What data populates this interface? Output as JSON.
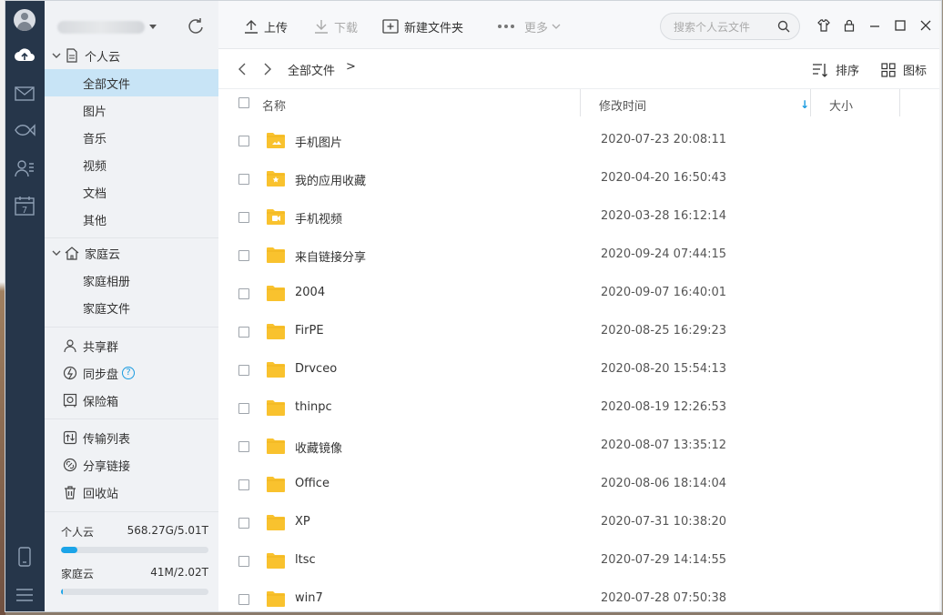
{
  "rail": {
    "icons": [
      "avatar-icon",
      "cloud-icon",
      "mail-icon",
      "fish-icon",
      "contacts-icon",
      "calendar-icon",
      "phone-icon",
      "menu-icon"
    ],
    "calendar_day": "7"
  },
  "sidebar": {
    "personal_cloud": {
      "label": "个人云",
      "items": [
        "全部文件",
        "图片",
        "音乐",
        "视频",
        "文档",
        "其他"
      ]
    },
    "family_cloud": {
      "label": "家庭云",
      "items": [
        "家庭相册",
        "家庭文件"
      ]
    },
    "utilities1": [
      {
        "label": "共享群",
        "icon": "people-icon"
      },
      {
        "label": "同步盘",
        "icon": "sync-disk-icon"
      },
      {
        "label": "保险箱",
        "icon": "safe-icon"
      }
    ],
    "help_glyph": "?",
    "utilities2": [
      {
        "label": "传输列表",
        "icon": "transfer-icon"
      },
      {
        "label": "分享链接",
        "icon": "share-link-icon"
      },
      {
        "label": "回收站",
        "icon": "trash-icon"
      }
    ],
    "quota": [
      {
        "label": "个人云",
        "value": "568.27G/5.01T",
        "fraction": 0.11
      },
      {
        "label": "家庭云",
        "value": "41M/2.02T",
        "fraction": 0.01
      }
    ]
  },
  "toolbar": {
    "upload": "上传",
    "download": "下载",
    "new_folder": "新建文件夹",
    "more": "更多",
    "search_placeholder": "搜索个人云文件"
  },
  "pathbar": {
    "crumb": "全部文件",
    "crumb_sep": ">",
    "sort": "排序",
    "view": "图标"
  },
  "columns": {
    "name": "名称",
    "modified": "修改时间",
    "size": "大小",
    "sort_glyph": "↓"
  },
  "files": [
    {
      "name": "手机图片",
      "date": "2020-07-23 20:08:11",
      "badge": "image"
    },
    {
      "name": "我的应用收藏",
      "date": "2020-04-20 16:50:43",
      "badge": "star"
    },
    {
      "name": "手机视频",
      "date": "2020-03-28 16:12:14",
      "badge": "video"
    },
    {
      "name": "来自链接分享",
      "date": "2020-09-24 07:44:15",
      "badge": ""
    },
    {
      "name": "2004",
      "date": "2020-09-07 16:40:01",
      "badge": ""
    },
    {
      "name": "FirPE",
      "date": "2020-08-25 16:29:23",
      "badge": ""
    },
    {
      "name": "Drvceo",
      "date": "2020-08-20 15:54:13",
      "badge": ""
    },
    {
      "name": "thinpc",
      "date": "2020-08-19 12:26:53",
      "badge": ""
    },
    {
      "name": "收藏镜像",
      "date": "2020-08-07 13:35:12",
      "badge": ""
    },
    {
      "name": "Office",
      "date": "2020-08-06 18:14:04",
      "badge": ""
    },
    {
      "name": "XP",
      "date": "2020-07-31 10:38:20",
      "badge": ""
    },
    {
      "name": "ltsc",
      "date": "2020-07-29 14:14:55",
      "badge": ""
    },
    {
      "name": "win7",
      "date": "2020-07-28 07:50:38",
      "badge": ""
    }
  ],
  "colors": {
    "rail": "#26364a",
    "sidebar": "#f0f2f5",
    "active": "#c8e4f6",
    "accent": "#1a9be0",
    "folder": "#f9c22e"
  }
}
